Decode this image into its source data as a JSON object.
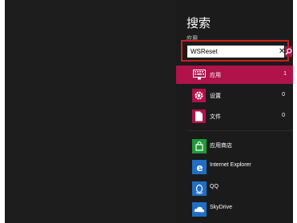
{
  "charm": {
    "title": "搜索",
    "scope": "应用",
    "search_value": "WSReset",
    "clear_glyph": "✕"
  },
  "categories": [
    {
      "label": "应用",
      "count": "1",
      "icon": "keyboard-icon"
    },
    {
      "label": "设置",
      "count": "0",
      "icon": "gear-icon"
    },
    {
      "label": "文件",
      "count": "0",
      "icon": "document-icon"
    }
  ],
  "apps": [
    {
      "label": "应用商店",
      "icon": "store-icon",
      "color": "#1f9a38"
    },
    {
      "label": "Internet Explorer",
      "icon": "ie-icon",
      "color": "#1f6fc4"
    },
    {
      "label": "QQ",
      "icon": "qq-icon",
      "color": "#1f6fc4"
    },
    {
      "label": "SkyDrive",
      "icon": "skydrive-icon",
      "color": "#1f6fc4"
    }
  ],
  "colors": {
    "accent": "#b0124a",
    "highlight_border": "#cc1f1f",
    "background": "#1b1b1b"
  }
}
